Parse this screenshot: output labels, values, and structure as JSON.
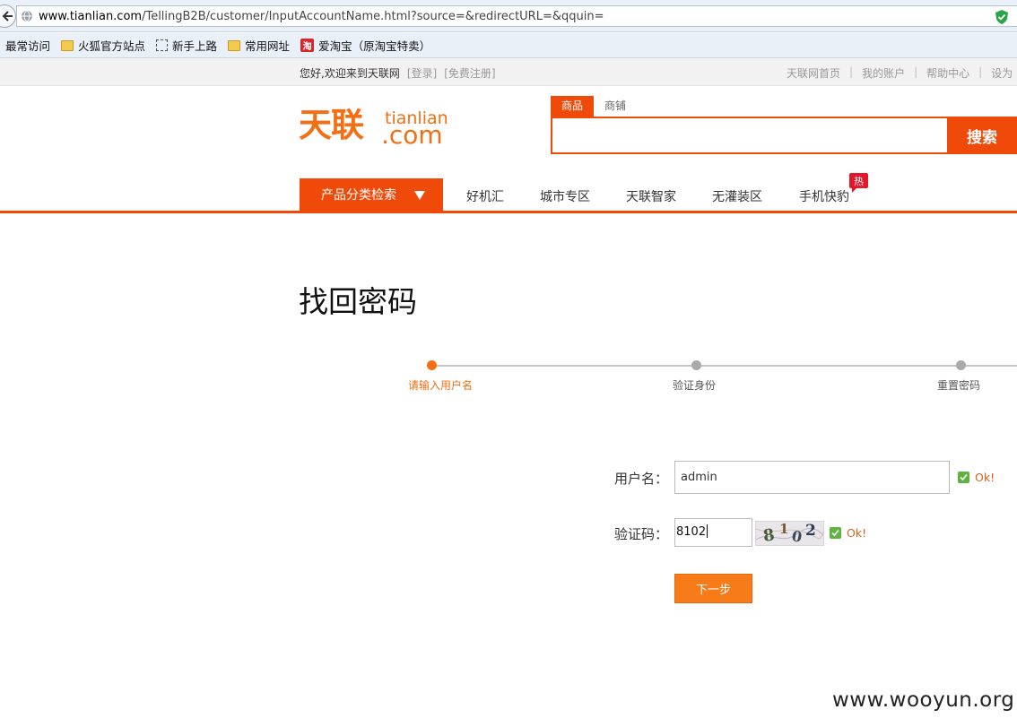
{
  "browser": {
    "url_host": "www.tianlian.com",
    "url_path": "/TellingB2B/customer/InputAccountName.html?source=&redirectURL=&qquin=",
    "bookmarks": [
      "最常访问",
      "火狐官方站点",
      "新手上路",
      "常用网址",
      "爱淘宝（原淘宝特卖）"
    ],
    "taobao_icon_text": "淘"
  },
  "site": {
    "welcome": "您好,欢迎来到天联网",
    "login": "[登录]",
    "register": "[免费注册]",
    "toplinks": [
      "天联网首页",
      "我的账户",
      "帮助中心",
      "设为"
    ],
    "logo_cn": "天联",
    "logo_en": "tianlian",
    "logo_com": ".com"
  },
  "search": {
    "tabs": [
      "商品",
      "商铺"
    ],
    "button": "搜索",
    "value": ""
  },
  "nav": {
    "category": "产品分类检索",
    "items": [
      "好机汇",
      "城市专区",
      "天联智家",
      "无灌装区",
      "手机快豹"
    ],
    "hot": "热"
  },
  "page": {
    "title": "找回密码",
    "steps": [
      "请输入用户名",
      "验证身份",
      "重置密码"
    ],
    "current_step": 1
  },
  "form": {
    "username_label": "用户名：",
    "username_value": "admin",
    "captcha_label": "验证码：",
    "captcha_value": "8102",
    "captcha_chars": [
      "8",
      "1",
      "0",
      "2"
    ],
    "ok_text": "Ok!",
    "next_button": "下一步"
  },
  "watermark": "www.wooyun.org",
  "colors": {
    "brand": "#f04a0a",
    "logo": "#f36f14",
    "button": "#f77b18",
    "ok": "#e0601a",
    "check": "#5fb341"
  }
}
